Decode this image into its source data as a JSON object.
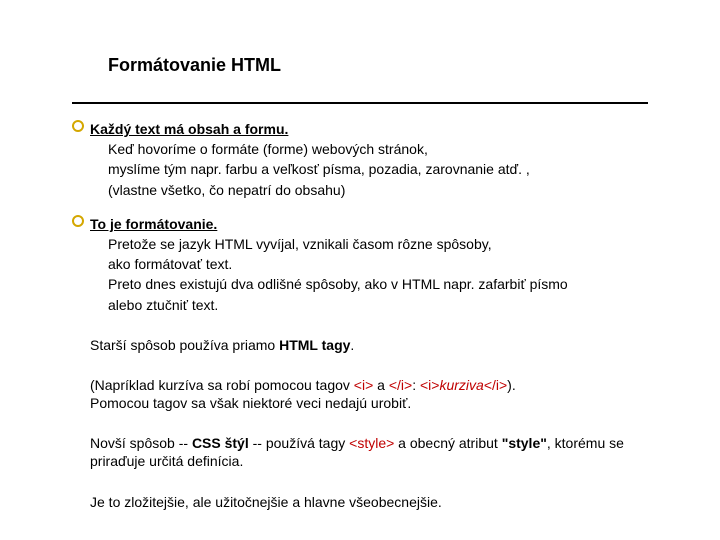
{
  "title": "Formátovanie HTML",
  "section1": {
    "lead": "Každý text má obsah a formu.",
    "l1": "Keď hovoríme o formáte (forme) webových stránok,",
    "l2": "myslíme tým napr. farbu a veľkosť písma, pozadia, zarovnanie atď. ,",
    "l3": "(vlastne všetko, čo nepatrí do obsahu)"
  },
  "section2": {
    "lead": "To je formátovanie.",
    "l1": "Pretože se jazyk HTML vyvíjal, vznikali časom rôzne spôsoby,",
    "l2": "ako formátovať text.",
    "l3": "Preto dnes existujú dva odlišné spôsoby, ako v HTML napr. zafarbiť písmo",
    "l4": "alebo ztučniť text."
  },
  "para1": {
    "pre": "Starší spôsob používa priamo ",
    "bold": "HTML tagy",
    "post": "."
  },
  "para2": {
    "pre": "(Napríklad kurzíva sa robí pomocou tagov ",
    "tag_open": "<i>",
    "mid": " a ",
    "tag_close": "</i>",
    "colon": ": ",
    "ex_open": "<i>",
    "ex_text": "kurziva",
    "ex_close": "</i>",
    "close_paren": ").",
    "line2": "Pomocou tagov sa však niektoré veci nedajú urobiť."
  },
  "para3": {
    "pre": "Novší spôsob -- ",
    "bold": "CSS štýl",
    "mid": " -- používá tagy ",
    "tag": "<style>",
    "post1": " a obecný atribut ",
    "attr": "\"style\"",
    "post2": ", ktorému se priraďuje určitá definícia."
  },
  "para4": "Je to zložitejšie, ale užitočnejšie a hlavne všeobecnejšie."
}
